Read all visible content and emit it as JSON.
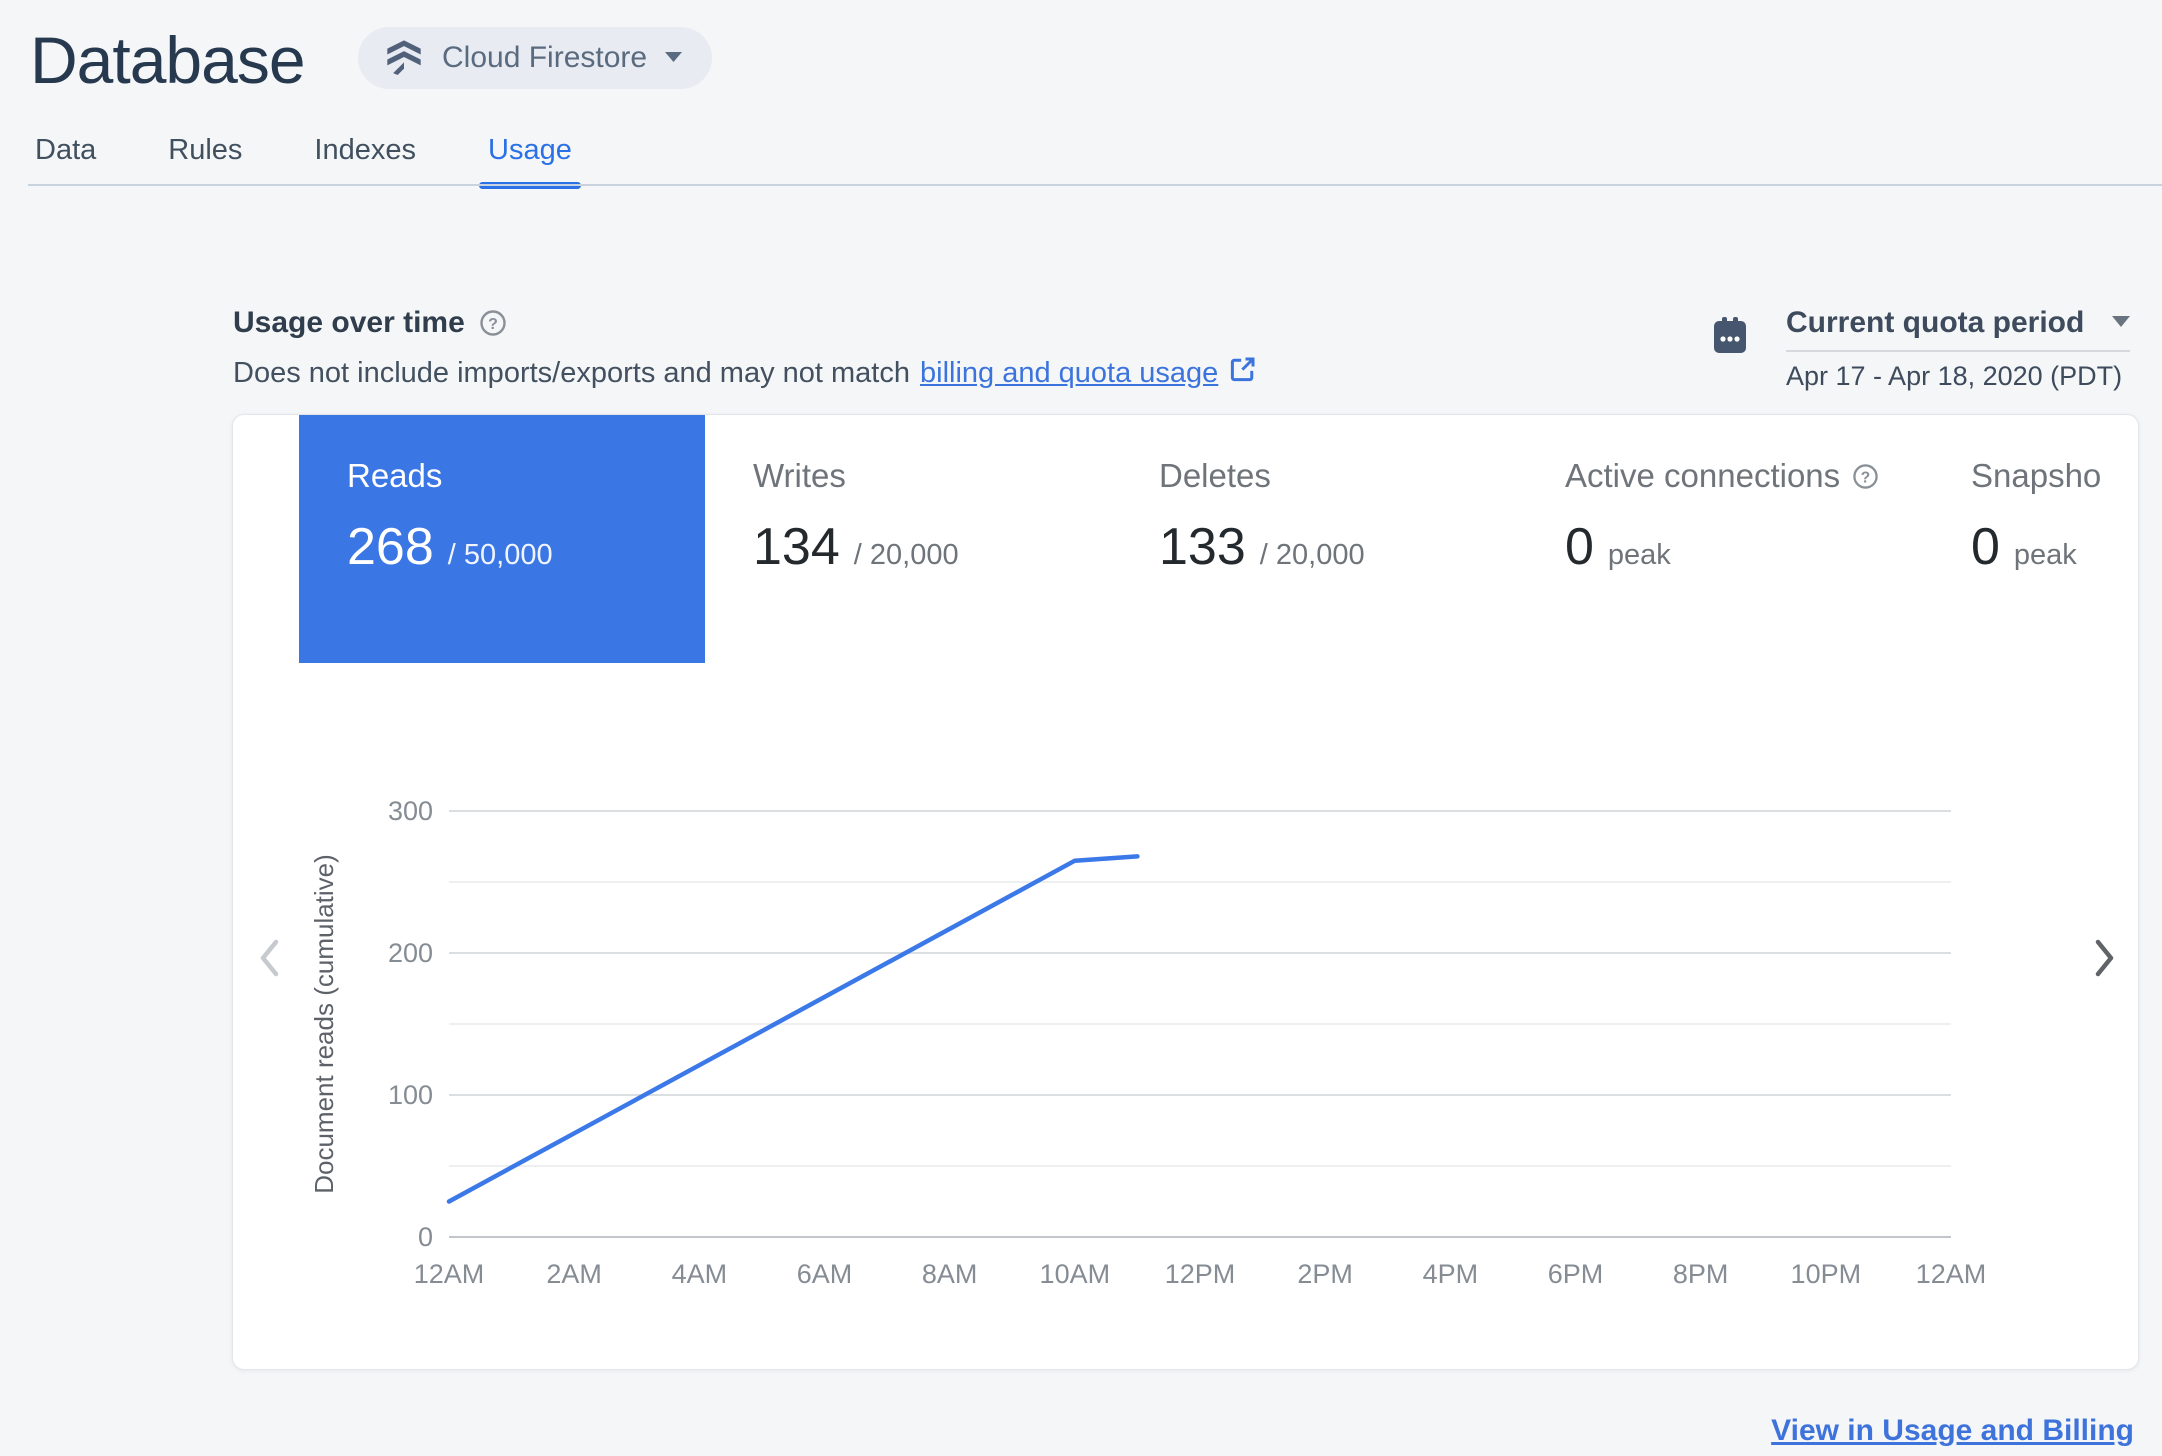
{
  "header": {
    "title": "Database",
    "product_selector": {
      "label": "Cloud Firestore"
    }
  },
  "tabs": {
    "items": [
      {
        "label": "Data",
        "active": false
      },
      {
        "label": "Rules",
        "active": false
      },
      {
        "label": "Indexes",
        "active": false
      },
      {
        "label": "Usage",
        "active": true
      }
    ]
  },
  "section": {
    "title": "Usage over time",
    "subtitle_prefix": "Does not include imports/exports and may not match",
    "subtitle_link": "billing and quota usage",
    "quota": {
      "label": "Current quota period",
      "range": "Apr 17 - Apr 18, 2020 (PDT)"
    }
  },
  "metrics": {
    "tiles": [
      {
        "label": "Reads",
        "value": "268",
        "suffix": "/ 50,000",
        "selected": true
      },
      {
        "label": "Writes",
        "value": "134",
        "suffix": "/ 20,000",
        "selected": false
      },
      {
        "label": "Deletes",
        "value": "133",
        "suffix": "/ 20,000",
        "selected": false
      },
      {
        "label": "Active connections",
        "value": "0",
        "suffix": "peak",
        "selected": false,
        "has_help": true
      },
      {
        "label": "Snapsho",
        "value": "0",
        "suffix": "peak",
        "selected": false
      }
    ]
  },
  "chart_data": {
    "type": "line",
    "title": "",
    "xlabel": "",
    "ylabel": "Document reads (cumulative)",
    "ylim": [
      0,
      300
    ],
    "yticks_labeled": [
      0,
      100,
      200,
      300
    ],
    "gridline_step": 50,
    "grid": true,
    "legend_position": "none",
    "x_hours_range": [
      0,
      24
    ],
    "xticks": [
      {
        "h": 0,
        "label": "12AM"
      },
      {
        "h": 2,
        "label": "2AM"
      },
      {
        "h": 4,
        "label": "4AM"
      },
      {
        "h": 6,
        "label": "6AM"
      },
      {
        "h": 8,
        "label": "8AM"
      },
      {
        "h": 10,
        "label": "10AM"
      },
      {
        "h": 12,
        "label": "12PM"
      },
      {
        "h": 14,
        "label": "2PM"
      },
      {
        "h": 16,
        "label": "4PM"
      },
      {
        "h": 18,
        "label": "6PM"
      },
      {
        "h": 20,
        "label": "8PM"
      },
      {
        "h": 22,
        "label": "10PM"
      },
      {
        "h": 24,
        "label": "12AM"
      }
    ],
    "series": [
      {
        "name": "Document reads (cumulative)",
        "points": [
          {
            "h": 0,
            "v": 25
          },
          {
            "h": 2,
            "v": 73
          },
          {
            "h": 4,
            "v": 121
          },
          {
            "h": 6,
            "v": 169
          },
          {
            "h": 8,
            "v": 217
          },
          {
            "h": 10,
            "v": 265
          },
          {
            "h": 11,
            "v": 268
          }
        ]
      }
    ]
  },
  "footer": {
    "billing_link": "View in Usage and Billing"
  },
  "colors": {
    "chart_line": "#3c79e8",
    "tile_selected_bg": "#3b76e5",
    "tab_active": "#2a70e6",
    "link_blue": "#3c74dd",
    "title_navy": "#26394e",
    "gridline_major": "#dcdfe2",
    "gridline_minor": "#edeff1",
    "gridline_baseline": "#c2c5c9",
    "page_bg": "#f5f6f8"
  }
}
